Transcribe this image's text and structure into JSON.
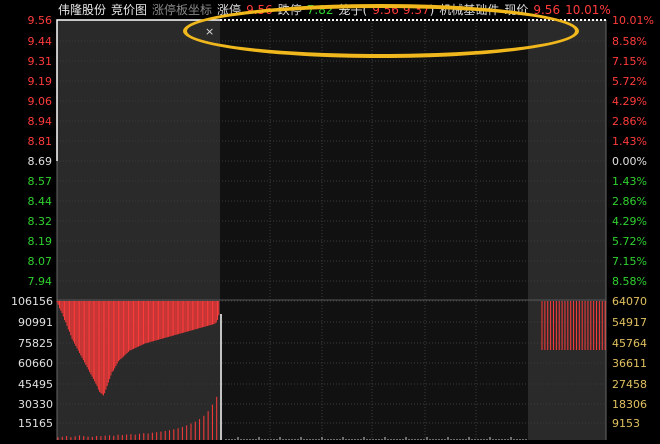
{
  "header": {
    "stock_name": "伟隆股份",
    "mode": "竞价图",
    "coord_toggle": "涨停板坐标",
    "limit_up_label": "涨停",
    "limit_up_value": "9.56",
    "limit_down_label": "跌停",
    "limit_down_value": "7.82",
    "cage_label": "笼子(",
    "cage_low": "9.56",
    "cage_high": "9.37",
    "cage_close": ")",
    "sector": "机械基础件",
    "now_label": "现价",
    "now_value": "9.56",
    "now_pct": "10.01%"
  },
  "close_icon": "×",
  "price_axis": {
    "left_labels": [
      "9.56",
      "9.44",
      "9.31",
      "9.19",
      "9.06",
      "8.94",
      "8.81",
      "8.69",
      "8.57",
      "8.44",
      "8.32",
      "8.19",
      "8.07",
      "7.94"
    ],
    "right_labels": [
      "10.01%",
      "8.58%",
      "7.15%",
      "5.72%",
      "4.29%",
      "2.86%",
      "1.43%",
      "0.00%",
      "1.43%",
      "2.86%",
      "4.29%",
      "5.72%",
      "7.15%",
      "8.58%"
    ],
    "label_colors": [
      "#ff3b3b",
      "#ff3b3b",
      "#ff3b3b",
      "#ff3b3b",
      "#ff3b3b",
      "#ff3b3b",
      "#ff3b3b",
      "#e0e0e0",
      "#2fd12f",
      "#2fd12f",
      "#2fd12f",
      "#2fd12f",
      "#2fd12f",
      "#2fd12f"
    ]
  },
  "volume_axis": {
    "left_labels": [
      "106156",
      "90991",
      "75825",
      "60660",
      "45495",
      "30330",
      "15165"
    ],
    "right_labels": [
      "64070",
      "54917",
      "45764",
      "36611",
      "27458",
      "18306",
      "9153"
    ]
  },
  "colors": {
    "up": "#ff3b3b",
    "down": "#2fd12f",
    "grid": "#3a3a3a",
    "panel_dark": "#111111",
    "panel_auction": "#2a2a2a",
    "accent_circle": "#f0b81c"
  },
  "chart_data": {
    "type": "bar",
    "left_auction_bars": [
      105000,
      103000,
      100000,
      98000,
      96000,
      93000,
      90000,
      88000,
      85000,
      82000,
      80000,
      77000,
      74000,
      72000,
      70000,
      68000,
      66000,
      64000,
      62000,
      60000,
      58000,
      56000,
      54000,
      52000,
      50000,
      48000,
      46000,
      44000,
      42000,
      40000,
      38000,
      36000,
      34000,
      31000,
      29000,
      28000,
      27000,
      26000,
      28000,
      31000,
      34000,
      37000,
      40000,
      43000,
      46000,
      47000,
      49000,
      51000,
      53000,
      55000,
      56000,
      57000,
      58000,
      59000,
      60000,
      61000,
      62000,
      63000,
      64000,
      64500,
      65000,
      65500,
      66000,
      66500,
      67000,
      67500,
      68000,
      68500,
      69000,
      69500,
      70000,
      70300,
      70600,
      70900,
      71200,
      71500,
      71800,
      72100,
      72400,
      72700,
      73000,
      73300,
      73600,
      73900,
      74200,
      74500,
      74800,
      75100,
      75400,
      75700,
      76000,
      76300,
      76600,
      76900,
      77200,
      77500,
      77800,
      78100,
      78400,
      78700,
      79000,
      79300,
      79600,
      79900,
      80200,
      80500,
      80800,
      81100,
      81400,
      81700,
      82000,
      82300,
      82600,
      82900,
      83200,
      83500,
      83800,
      84100,
      84400,
      84700,
      85000,
      85300,
      85600,
      85900,
      86200,
      86500,
      87000,
      88000,
      90000,
      94000
    ],
    "left_auction_bottom_bars": [
      2000,
      2500,
      3000,
      2200,
      2800,
      3500,
      3000,
      2600,
      2400,
      3100,
      2900,
      3300,
      3600,
      3200,
      4000,
      3800,
      4200,
      4500,
      4100,
      4800,
      5200,
      5000,
      5600,
      6000,
      6400,
      6900,
      7500,
      8200,
      9000,
      10000,
      11200,
      12600,
      14000,
      16000,
      18500,
      22000,
      27000,
      33000
    ],
    "right_auction_bars": [
      64070,
      64070,
      64070,
      64070,
      64070,
      64070,
      64070,
      64070,
      64070,
      64070,
      64070,
      64070,
      64070,
      64070,
      64070,
      64070,
      64070,
      64070,
      64070,
      64070,
      64070,
      64070,
      64070
    ],
    "ylim_volume": [
      0,
      106156
    ]
  }
}
